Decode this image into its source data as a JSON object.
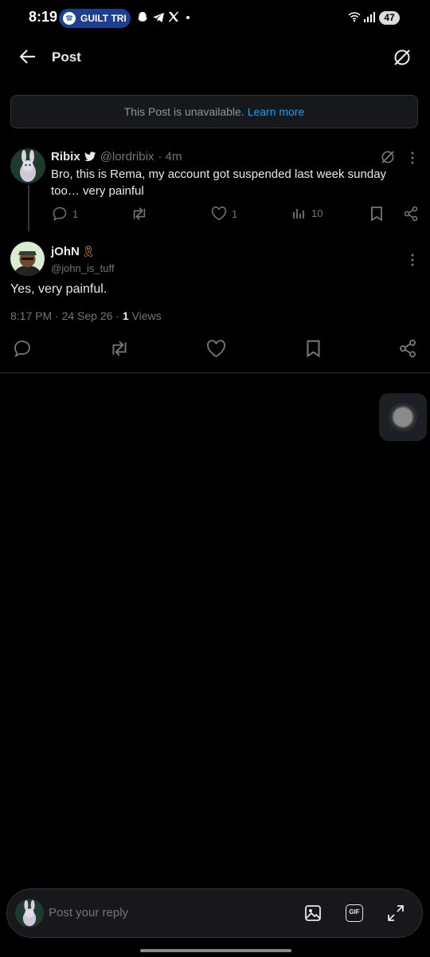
{
  "status_bar": {
    "time": "8:19",
    "media_pill_text": "GUILT TRI",
    "battery": "47",
    "icons": [
      "snapchat-icon",
      "telegram-icon",
      "x-icon",
      "wifi-icon",
      "signal-icon"
    ]
  },
  "header": {
    "title": "Post"
  },
  "unavailable": {
    "text": "This Post is unavailable.",
    "link": "Learn more"
  },
  "reply_post": {
    "name": "Ribix",
    "handle": "@lordribix",
    "time": "· 4m",
    "text": "Bro, this is Rema, my account got suspended last week sunday too… very painful",
    "replies": "1",
    "likes": "1",
    "views": "10"
  },
  "main_post": {
    "name": "jOhN",
    "name_emoji": "🎗",
    "handle": "@john_is_tuff",
    "text": "Yes, very painful.",
    "timestamp": "8:17 PM · 24 Sep 26 · ",
    "views_count": "1",
    "views_label": " Views"
  },
  "composer": {
    "placeholder": "Post your reply",
    "gif_label": "GIF"
  },
  "colors": {
    "background": "#000000",
    "accent": "#1d9bf0",
    "muted": "#71767b"
  }
}
